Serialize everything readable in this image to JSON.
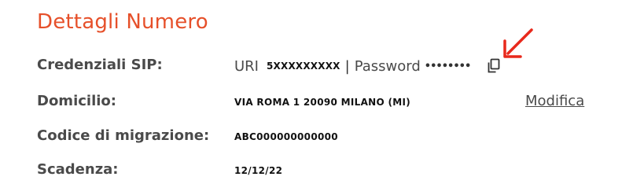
{
  "section": {
    "title": "Dettagli Numero"
  },
  "sip": {
    "label": "Credenziali SIP:",
    "uri_label": "URI",
    "uri_value": "5XXXXXXXXX",
    "separator": "|",
    "password_label": "Password",
    "password_value": "••••••••",
    "copy_icon": "copy-icon"
  },
  "domicilio": {
    "label": "Domicilio:",
    "value": "VIA ROMA 1 20090 MILANO (MI)",
    "edit_link": "Modifica"
  },
  "migrazione": {
    "label": "Codice di migrazione:",
    "value": "ABC000000000000"
  },
  "scadenza": {
    "label": "Scadenza:",
    "value": "12/12/22"
  },
  "colors": {
    "title": "#e6502a",
    "annotation_arrow": "#e8291c",
    "label_text": "#4a4a4a"
  }
}
